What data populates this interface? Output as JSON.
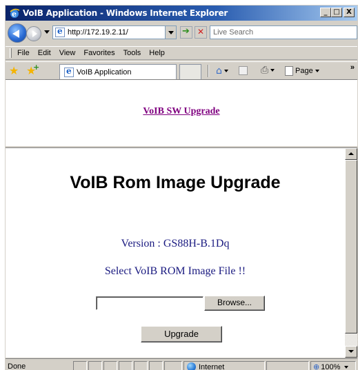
{
  "window": {
    "title": "VoIB Application - Windows Internet Explorer",
    "minimize": "_",
    "maximize": "□",
    "close": "X"
  },
  "address_bar": {
    "url": "http://172.19.2.11/",
    "search_placeholder": "Live Search"
  },
  "menu": {
    "items": [
      "File",
      "Edit",
      "View",
      "Favorites",
      "Tools",
      "Help"
    ]
  },
  "tabs": {
    "active_label": "VoIB Application",
    "page_menu_label": "Page",
    "overflow": "»"
  },
  "top_frame": {
    "link_text": "VoIB SW Upgrade"
  },
  "main": {
    "heading": "VoIB Rom Image Upgrade",
    "version_text": "Version : GS88H-B.1Dq",
    "instruction": "Select VoIB ROM Image File !!",
    "file_value": "",
    "browse_label": "Browse...",
    "upgrade_label": "Upgrade"
  },
  "status_bar": {
    "status": "Done",
    "zone": "Internet",
    "zoom": "100%"
  },
  "icons": {
    "back": "back-arrow-icon",
    "forward": "forward-arrow-icon",
    "go": "go-arrow-icon",
    "stop": "stop-icon",
    "favorites": "favorites-star-icon",
    "add_favorites": "add-favorites-icon",
    "home": "home-icon",
    "feeds": "feeds-icon",
    "print": "print-icon",
    "globe": "globe-icon",
    "zoom": "zoom-icon"
  },
  "colors": {
    "titlebar": "#0a246a",
    "visited_link": "#800080",
    "body_text_blue": "#1a1a80",
    "chrome": "#d4d0c8"
  }
}
